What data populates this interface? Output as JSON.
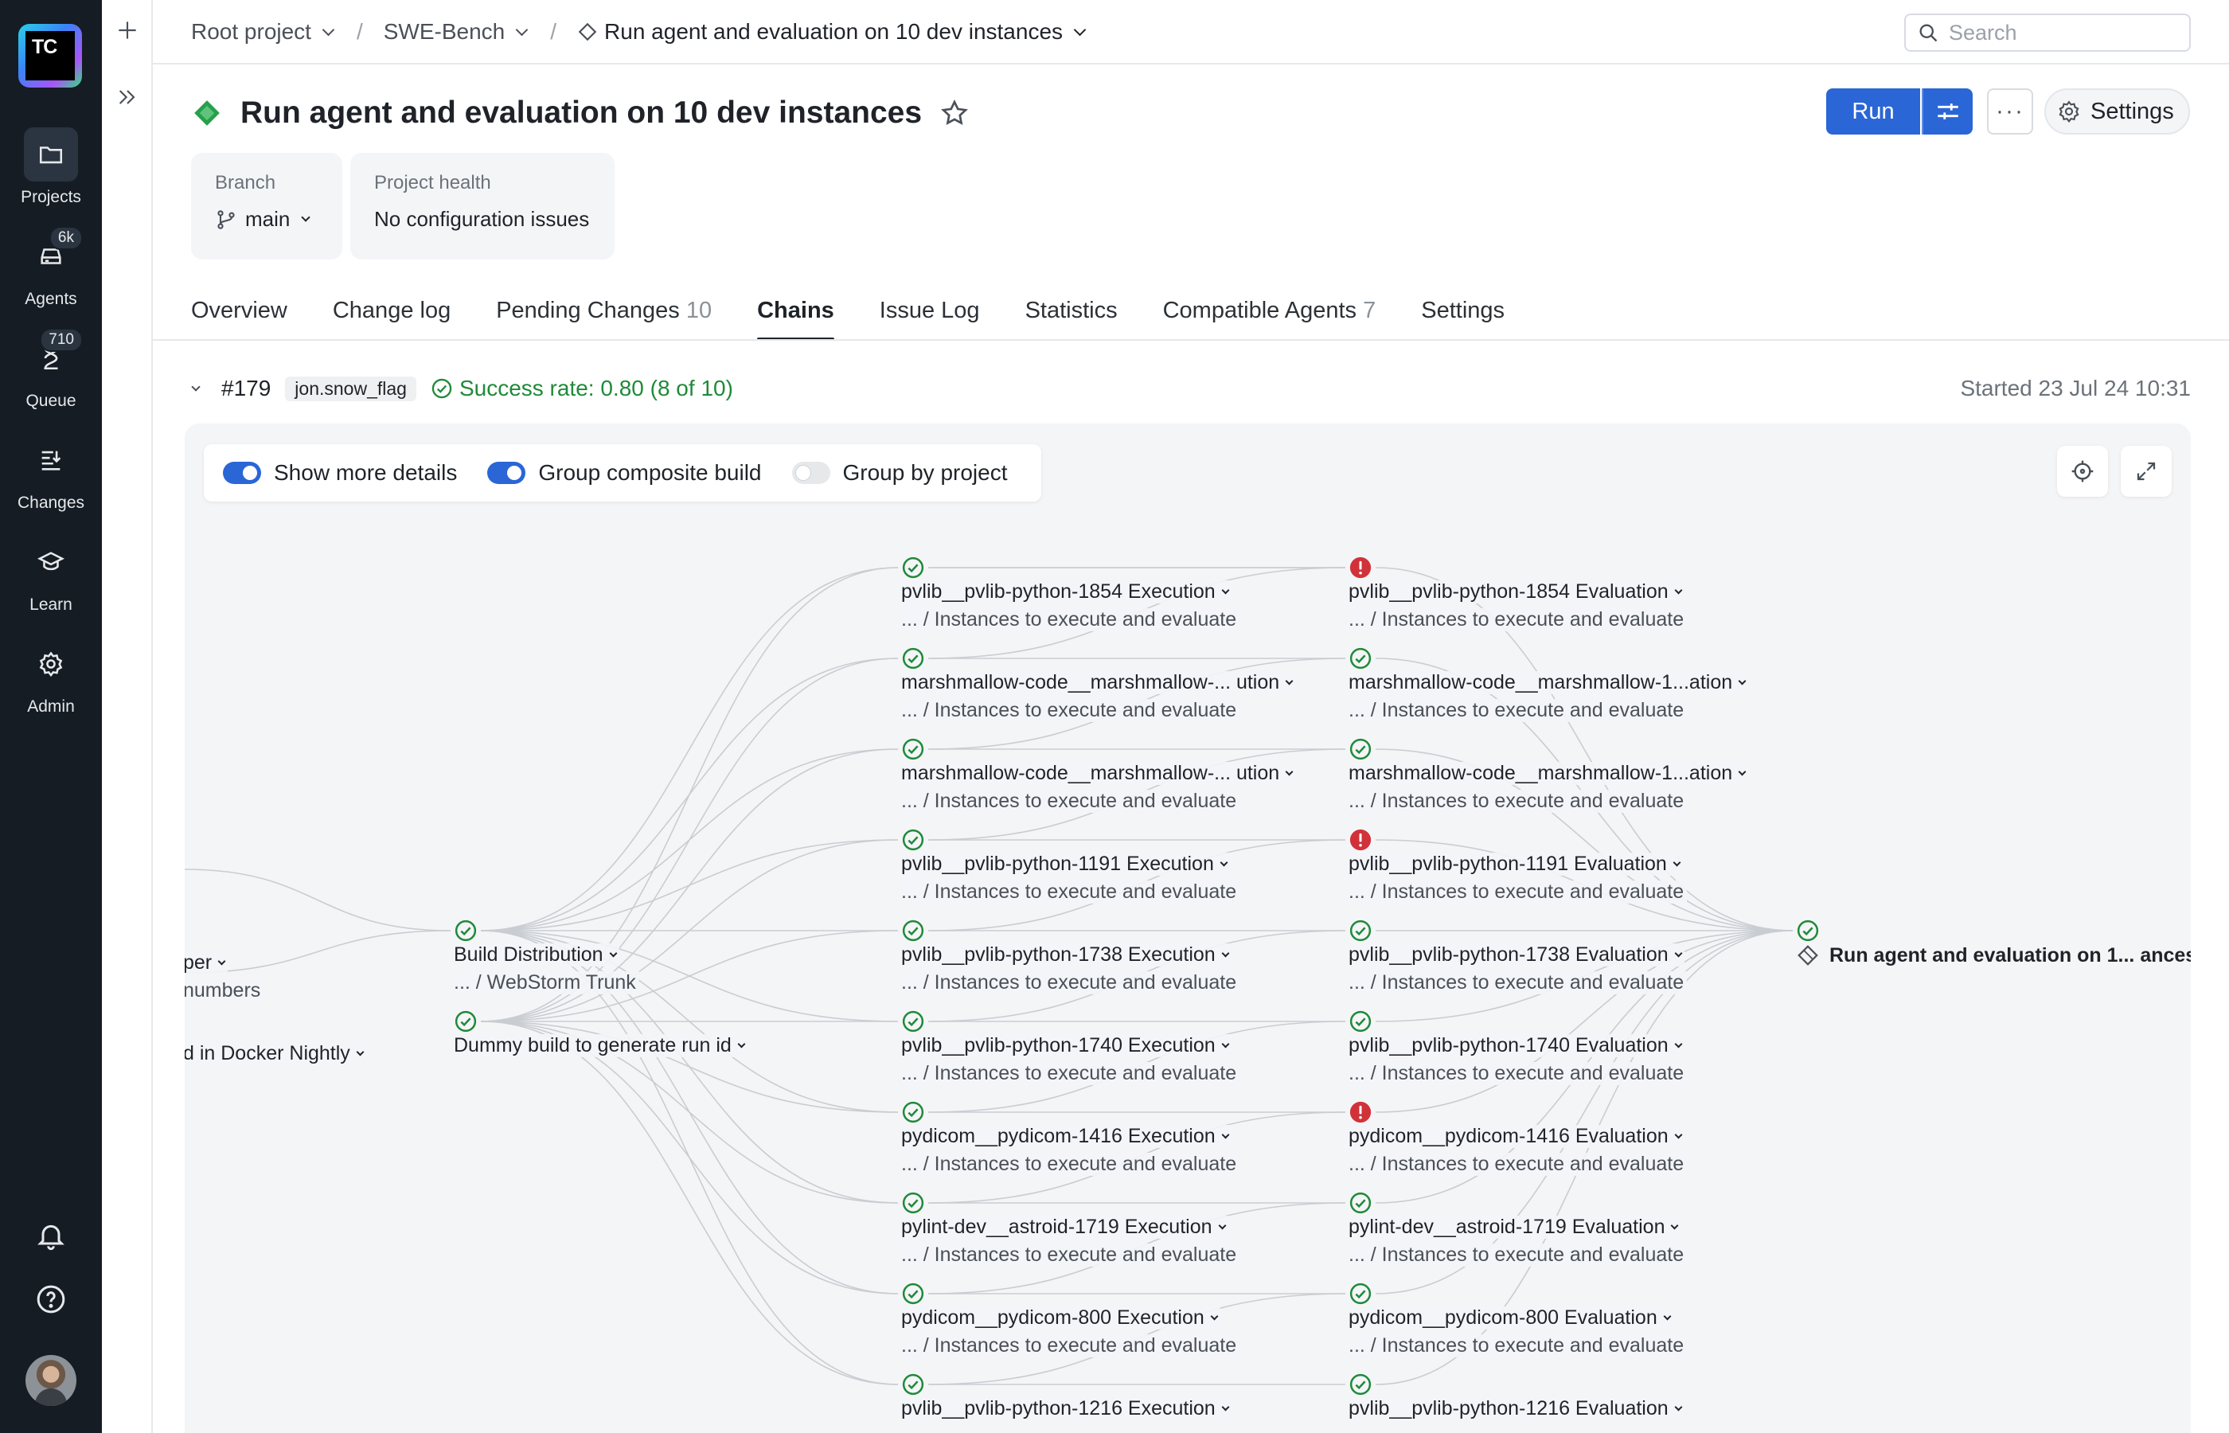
{
  "rail": {
    "logo_text": "TC",
    "items": [
      {
        "label": "Projects",
        "icon": "folder-icon",
        "badge": ""
      },
      {
        "label": "Agents",
        "icon": "agents-icon",
        "badge": "6k"
      },
      {
        "label": "Queue",
        "icon": "hourglass-icon",
        "badge": "710"
      },
      {
        "label": "Changes",
        "icon": "changes-icon",
        "badge": ""
      },
      {
        "label": "Learn",
        "icon": "graduation-cap-icon",
        "badge": ""
      },
      {
        "label": "Admin",
        "icon": "gear-icon",
        "badge": ""
      }
    ]
  },
  "breadcrumbs": {
    "root": "Root project",
    "project": "SWE-Bench",
    "current": "Run agent and evaluation on 10 dev instances"
  },
  "search": {
    "placeholder": "Search"
  },
  "header": {
    "title": "Run agent and evaluation on 10 dev instances",
    "run_label": "Run",
    "more_label": "···",
    "settings_label": "Settings"
  },
  "cards": {
    "branch_label": "Branch",
    "branch_value": "main",
    "health_label": "Project health",
    "health_value": "No configuration issues"
  },
  "tabs": [
    {
      "label": "Overview",
      "count": ""
    },
    {
      "label": "Change log",
      "count": ""
    },
    {
      "label": "Pending Changes",
      "count": "10"
    },
    {
      "label": "Chains",
      "count": ""
    },
    {
      "label": "Issue Log",
      "count": ""
    },
    {
      "label": "Statistics",
      "count": ""
    },
    {
      "label": "Compatible Agents",
      "count": "7"
    },
    {
      "label": "Settings",
      "count": ""
    }
  ],
  "run": {
    "number": "#179",
    "tag": "jon.snow_flag",
    "success": "Success rate: 0.80 (8 of 10)",
    "started": "Started 23 Jul 24 10:31"
  },
  "toggles": [
    {
      "label": "Show more details",
      "on": true
    },
    {
      "label": "Group composite build",
      "on": true
    },
    {
      "label": "Group by project",
      "on": false
    }
  ],
  "colors": {
    "accent": "#2a66d6",
    "success": "#1f8a3a",
    "error": "#d1323a"
  },
  "graph": {
    "left_nodes": [
      {
        "name": "per",
        "sub": "numbers"
      },
      {
        "name": "d in Docker Nightly",
        "sub": ""
      }
    ],
    "mid_nodes": [
      {
        "name": "Build Distribution",
        "sub": "... / WebStorm Trunk",
        "status": "success"
      },
      {
        "name": "Dummy build to generate run id",
        "sub": "",
        "status": "success"
      }
    ],
    "exec_nodes": [
      {
        "name": "pvlib__pvlib-python-1854 Execution",
        "sub": "... / Instances to execute and evaluate",
        "status": "success"
      },
      {
        "name": "marshmallow-code__marshmallow-...  ution",
        "sub": "... / Instances to execute and evaluate",
        "status": "success"
      },
      {
        "name": "marshmallow-code__marshmallow-...  ution",
        "sub": "... / Instances to execute and evaluate",
        "status": "success"
      },
      {
        "name": "pvlib__pvlib-python-1191 Execution",
        "sub": "... / Instances to execute and evaluate",
        "status": "success"
      },
      {
        "name": "pvlib__pvlib-python-1738 Execution",
        "sub": "... / Instances to execute and evaluate",
        "status": "success"
      },
      {
        "name": "pvlib__pvlib-python-1740 Execution",
        "sub": "... / Instances to execute and evaluate",
        "status": "success"
      },
      {
        "name": "pydicom__pydicom-1416 Execution",
        "sub": "... / Instances to execute and evaluate",
        "status": "success"
      },
      {
        "name": "pylint-dev__astroid-1719 Execution",
        "sub": "... / Instances to execute and evaluate",
        "status": "success"
      },
      {
        "name": "pydicom__pydicom-800 Execution",
        "sub": "... / Instances to execute and evaluate",
        "status": "success"
      },
      {
        "name": "pvlib__pvlib-python-1216 Execution",
        "sub": "",
        "status": "success"
      }
    ],
    "eval_nodes": [
      {
        "name": "pvlib__pvlib-python-1854 Evaluation",
        "sub": "... / Instances to execute and evaluate",
        "status": "error"
      },
      {
        "name": "marshmallow-code__marshmallow-1...ation",
        "sub": "... / Instances to execute and evaluate",
        "status": "success"
      },
      {
        "name": "marshmallow-code__marshmallow-1...ation",
        "sub": "... / Instances to execute and evaluate",
        "status": "success"
      },
      {
        "name": "pvlib__pvlib-python-1191 Evaluation",
        "sub": "... / Instances to execute and evaluate",
        "status": "error"
      },
      {
        "name": "pvlib__pvlib-python-1738 Evaluation",
        "sub": "... / Instances to execute and evaluate",
        "status": "success"
      },
      {
        "name": "pvlib__pvlib-python-1740 Evaluation",
        "sub": "... / Instances to execute and evaluate",
        "status": "success"
      },
      {
        "name": "pydicom__pydicom-1416 Evaluation",
        "sub": "... / Instances to execute and evaluate",
        "status": "error"
      },
      {
        "name": "pylint-dev__astroid-1719 Evaluation",
        "sub": "... / Instances to execute and evaluate",
        "status": "success"
      },
      {
        "name": "pydicom__pydicom-800 Evaluation",
        "sub": "... / Instances to execute and evaluate",
        "status": "success"
      },
      {
        "name": "pvlib__pvlib-python-1216 Evaluation",
        "sub": "",
        "status": "success"
      }
    ],
    "final_node": {
      "name": "Run agent and evaluation on 1...  ances",
      "status": "success"
    }
  }
}
